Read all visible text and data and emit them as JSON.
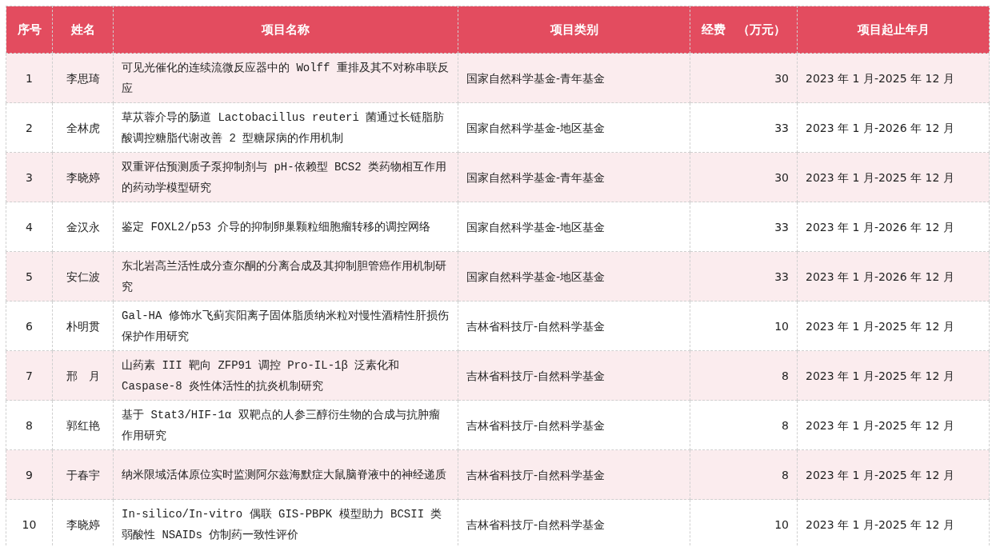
{
  "table": {
    "columns": [
      "序号",
      "姓名",
      "项目名称",
      "项目类别",
      "经费　（万元）",
      "项目起止年月"
    ],
    "rows": [
      {
        "no": "1",
        "name": "李思琦",
        "project": "可见光催化的连续流微反应器中的 Wolff 重排及其不对称串联反应",
        "category": "国家自然科学基金-青年基金",
        "funding": "30",
        "period": "2023 年 1 月-2025 年 12 月"
      },
      {
        "no": "2",
        "name": "全林虎",
        "project": "草苁蓉介导的肠道 Lactobacillus reuteri 菌通过长链脂肪酸调控糖脂代谢改善 2 型糖尿病的作用机制",
        "category": "国家自然科学基金-地区基金",
        "funding": "33",
        "period": "2023 年 1 月-2026 年 12 月"
      },
      {
        "no": "3",
        "name": "李晓婷",
        "project": "双重评估预测质子泵抑制剂与 pH-依赖型 BCS2 类药物相互作用的药动学模型研究",
        "category": "国家自然科学基金-青年基金",
        "funding": "30",
        "period": "2023 年 1 月-2025 年 12 月"
      },
      {
        "no": "4",
        "name": "金汉永",
        "project": "鉴定 FOXL2/p53 介导的抑制卵巢颗粒细胞瘤转移的调控网络",
        "category": "国家自然科学基金-地区基金",
        "funding": "33",
        "period": "2023 年 1 月-2026 年 12 月"
      },
      {
        "no": "5",
        "name": "安仁波",
        "project": "东北岩高兰活性成分查尔酮的分离合成及其抑制胆管癌作用机制研究",
        "category": "国家自然科学基金-地区基金",
        "funding": "33",
        "period": "2023 年 1 月-2026 年 12 月"
      },
      {
        "no": "6",
        "name": "朴明贯",
        "project": "Gal-HA 修饰水飞蓟宾阳离子固体脂质纳米粒对慢性酒精性肝损伤保护作用研究",
        "category": "吉林省科技厅-自然科学基金",
        "funding": "10",
        "period": "2023 年 1 月-2025 年 12 月"
      },
      {
        "no": "7",
        "name": "邢　月",
        "project": "山药素 III 靶向 ZFP91 调控 Pro-IL-1β 泛素化和 Caspase-8 炎性体活性的抗炎机制研究",
        "category": "吉林省科技厅-自然科学基金",
        "funding": "8",
        "period": "2023 年 1 月-2025 年 12 月"
      },
      {
        "no": "8",
        "name": "郭红艳",
        "project": "基于 Stat3/HIF-1α 双靶点的人参三醇衍生物的合成与抗肿瘤作用研究",
        "category": "吉林省科技厅-自然科学基金",
        "funding": "8",
        "period": "2023 年 1 月-2025 年 12 月"
      },
      {
        "no": "9",
        "name": "于春宇",
        "project": "纳米限域活体原位实时监测阿尔兹海默症大鼠脑脊液中的神经递质",
        "category": "吉林省科技厅-自然科学基金",
        "funding": "8",
        "period": "2023 年 1 月-2025 年 12 月"
      },
      {
        "no": "10",
        "name": "李晓婷",
        "project": "In-silico/In-vitro 偶联 GIS-PBPK 模型助力 BCSII 类弱酸性 NSAIDs 仿制药一致性评价",
        "category": "吉林省科技厅-自然科学基金",
        "funding": "10",
        "period": "2023 年 1 月-2025 年 12 月"
      }
    ]
  }
}
